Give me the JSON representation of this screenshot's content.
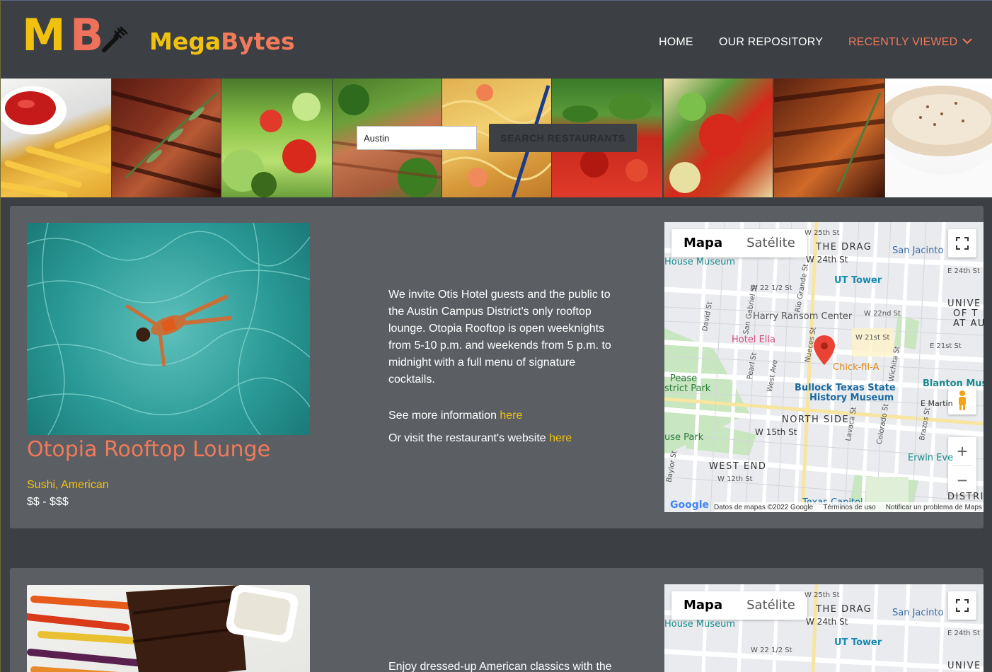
{
  "header": {
    "logo_m": "M",
    "logo_b": "B",
    "brand_mega": "Mega",
    "brand_bytes": "Bytes",
    "nav": {
      "home": "HOME",
      "repository": "OUR REPOSITORY",
      "recently_viewed": "RECENTLY VIEWED"
    }
  },
  "search": {
    "value": "Austin",
    "button_label": "SEARCH RESTAURANTS"
  },
  "restaurants": [
    {
      "name": "Otopia Rooftop Lounge",
      "categories": "Sushi, American",
      "price": "$$ - $$$",
      "description": "We invite Otis Hotel guests and the public to the Austin Campus District's only rooftop lounge. Otopia Rooftop is open weeknights from 5-10 p.m. and weekends from 5 p.m. to midnight with a full menu of signature cocktails.",
      "more_info_text": "See more information ",
      "more_info_link": "here",
      "website_text": "Or visit the restaurant's website ",
      "website_link": "here"
    },
    {
      "description": "Enjoy dressed-up American classics with the"
    }
  ],
  "map": {
    "type_map": "Mapa",
    "type_satellite": "Satélite",
    "footer_data": "Datos de mapas ©2022 Google",
    "footer_terms": "Términos de uso",
    "footer_report": "Notificar un problema de Maps",
    "google": "Google",
    "labels": {
      "the_drag": "THE DRAG",
      "w25": "W 25th St",
      "w24": "W 24th St",
      "e24": "E 24th St",
      "san_jacinto": "San Jacinto",
      "house_museum": "House Museum",
      "ut_tower": "UT Tower",
      "univ1": "UNIVE",
      "univ2": "OF T",
      "univ3": "AT AU",
      "harry": "Harry Ransom Center",
      "w22": "W 22nd St",
      "w22half": "W 22 1/2 St",
      "hotel_ella": "Hotel Ella",
      "w21": "W 21st St",
      "e21": "E 21st St",
      "chick": "Chick-fil-A",
      "pease1": "Pease",
      "pease2": "strict Park",
      "bullock1": "Bullock Texas State",
      "bullock2": "History Museum",
      "blanton": "Blanton Muse",
      "north_side": "NORTH SIDE",
      "w15": "W 15th St",
      "use_park": "use Park",
      "west_end": "WEST END",
      "w12": "W 12th St",
      "erwin": "Erwin Eve",
      "texas_capitol": "Texas Capitol",
      "distri": "DISTRI",
      "david": "David St",
      "san_gabriel": "San Gabriel St",
      "rio_grande": "Rio Grande St",
      "nueces": "Nueces St",
      "pearl": "Pearl St",
      "west_ave": "West Ave",
      "lavaca": "Lavaca St",
      "colorado": "Colorado St",
      "brazos": "Brazos St",
      "wichita": "Wichita St",
      "martin": "E Martin",
      "baylor": "Baylor St"
    }
  },
  "colors": {
    "bg": "#3c3f43",
    "card": "#5b5f64",
    "yellow": "#f0c20f",
    "coral": "#f07a5a"
  }
}
